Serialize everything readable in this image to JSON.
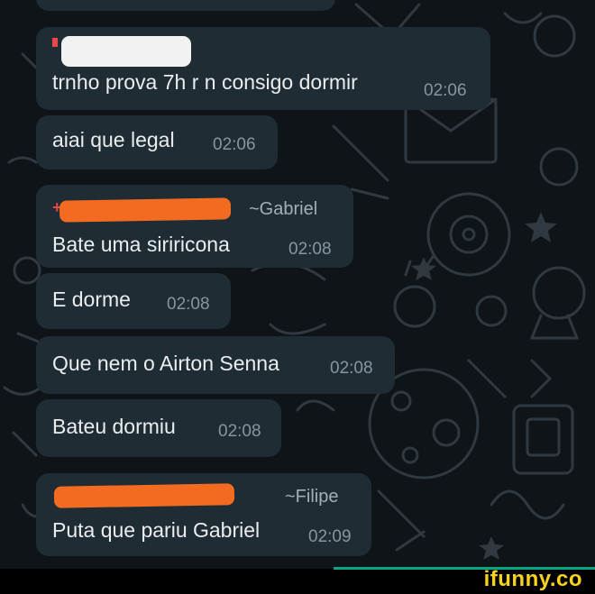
{
  "chat": {
    "messages": [
      {
        "text": "trnho prova 7h r n consigo dormir",
        "time": "02:06"
      },
      {
        "text": "aiai que legal",
        "time": "02:06"
      },
      {
        "sender": "~Gabriel",
        "text": "Bate uma siriricona",
        "time": "02:08"
      },
      {
        "text": "E dorme",
        "time": "02:08"
      },
      {
        "text": "Que nem o Airton Senna",
        "time": "02:08"
      },
      {
        "text": "Bateu dormiu",
        "time": "02:08"
      },
      {
        "sender": "~Filipe",
        "text": "Puta que pariu Gabriel",
        "time": "02:09"
      }
    ]
  },
  "watermark": {
    "text": "ifunny.co"
  },
  "colors": {
    "background": "#0f1418",
    "bubble": "#1f2c34",
    "text": "#e9edef",
    "timestamp": "#8696a0",
    "redaction_orange": "#f26b21",
    "watermark": "#f7d21e"
  }
}
